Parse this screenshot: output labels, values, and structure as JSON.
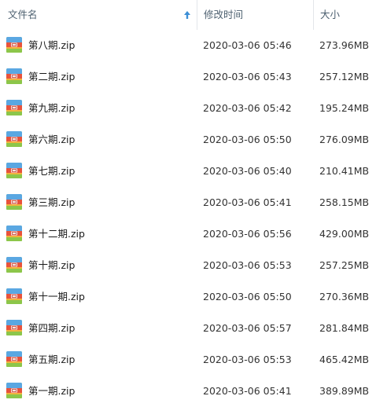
{
  "header": {
    "name_label": "文件名",
    "date_label": "修改时间",
    "size_label": "大小",
    "sort_icon": "arrow-up-icon",
    "sort_color": "#3c8fd6"
  },
  "file_icon": "zip-archive-icon",
  "files": [
    {
      "name": "第八期.zip",
      "modified": "2020-03-06 05:46",
      "size": "273.96MB"
    },
    {
      "name": "第二期.zip",
      "modified": "2020-03-06 05:43",
      "size": "257.12MB"
    },
    {
      "name": "第九期.zip",
      "modified": "2020-03-06 05:42",
      "size": "195.24MB"
    },
    {
      "name": "第六期.zip",
      "modified": "2020-03-06 05:50",
      "size": "276.09MB"
    },
    {
      "name": "第七期.zip",
      "modified": "2020-03-06 05:40",
      "size": "210.41MB"
    },
    {
      "name": "第三期.zip",
      "modified": "2020-03-06 05:41",
      "size": "258.15MB"
    },
    {
      "name": "第十二期.zip",
      "modified": "2020-03-06 05:56",
      "size": "429.00MB"
    },
    {
      "name": "第十期.zip",
      "modified": "2020-03-06 05:53",
      "size": "257.25MB"
    },
    {
      "name": "第十一期.zip",
      "modified": "2020-03-06 05:50",
      "size": "270.36MB"
    },
    {
      "name": "第四期.zip",
      "modified": "2020-03-06 05:57",
      "size": "281.84MB"
    },
    {
      "name": "第五期.zip",
      "modified": "2020-03-06 05:53",
      "size": "465.42MB"
    },
    {
      "name": "第一期.zip",
      "modified": "2020-03-06 05:41",
      "size": "389.89MB"
    }
  ]
}
